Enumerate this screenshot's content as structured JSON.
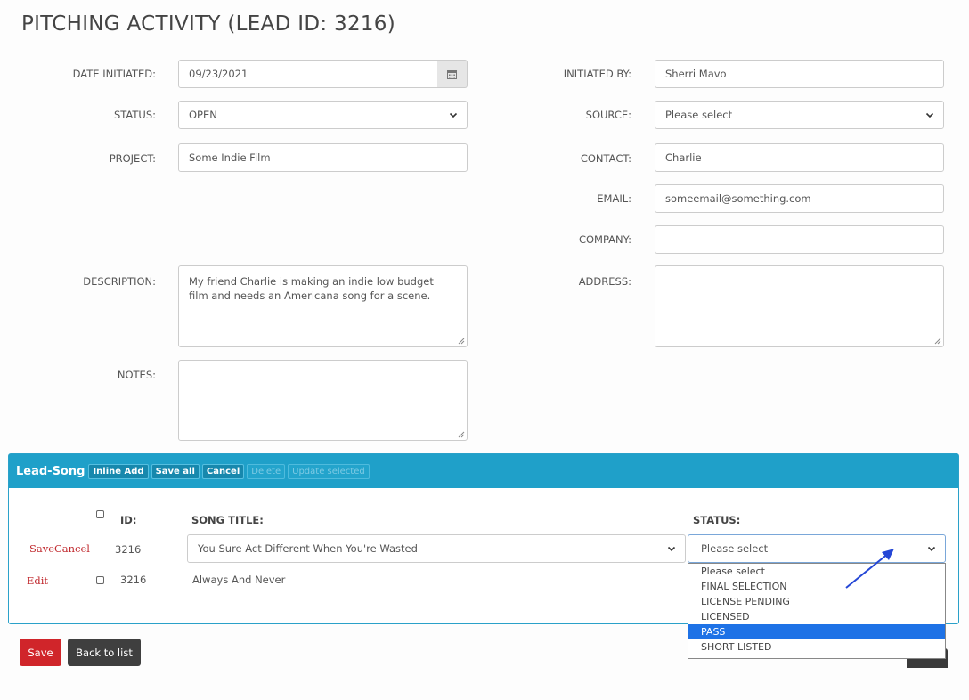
{
  "page_title": "PITCHING ACTIVITY (LEAD ID: 3216)",
  "form": {
    "date_initiated": {
      "label": "DATE INITIATED:",
      "value": "09/23/2021"
    },
    "status": {
      "label": "STATUS:",
      "value": "OPEN"
    },
    "project": {
      "label": "PROJECT:",
      "value": "Some Indie Film"
    },
    "description": {
      "label": "DESCRIPTION:",
      "value": "My friend Charlie is making an indie low budget film and needs an Americana song for a scene."
    },
    "notes": {
      "label": "NOTES:",
      "value": ""
    },
    "initiated_by": {
      "label": "INITIATED BY:",
      "value": "Sherri Mavo"
    },
    "source": {
      "label": "SOURCE:",
      "value": "Please select"
    },
    "contact": {
      "label": "CONTACT:",
      "value": "Charlie"
    },
    "email": {
      "label": "EMAIL:",
      "value": "someemail@something.com"
    },
    "company": {
      "label": "COMPANY:",
      "value": ""
    },
    "address": {
      "label": "ADDRESS:",
      "value": ""
    }
  },
  "panel": {
    "title": "Lead-Song",
    "buttons": {
      "inline_add": "Inline Add",
      "save_all": "Save all",
      "cancel": "Cancel",
      "delete": "Delete",
      "update_selected": "Update selected"
    },
    "columns": {
      "id": "ID:",
      "song_title": "SONG TITLE:",
      "status": "STATUS:"
    },
    "rows": [
      {
        "actions": {
          "save": "Save",
          "cancel": "Cancel"
        },
        "id": "3216",
        "song_title": "You Sure Act Different When You're Wasted",
        "status": "Please select"
      },
      {
        "actions": {
          "edit": "Edit"
        },
        "id": "3216",
        "song_title": "Always And Never",
        "status": ""
      }
    ],
    "status_options": [
      "Please select",
      "FINAL SELECTION",
      "LICENSE PENDING",
      "LICENSED",
      "PASS",
      "SHORT LISTED"
    ],
    "highlighted_option": "PASS"
  },
  "footer": {
    "save": "Save",
    "back": "Back to list"
  },
  "colors": {
    "panel_header": "#1fa0c9",
    "save_button": "#d0252a",
    "back_button": "#3f3f3f",
    "dropdown_highlight": "#1e72e6",
    "annotation_arrow": "#2547d6"
  },
  "icons": {
    "calendar": "calendar-icon",
    "chevron": "chevron-down-icon",
    "arrow": "annotation-arrow"
  }
}
